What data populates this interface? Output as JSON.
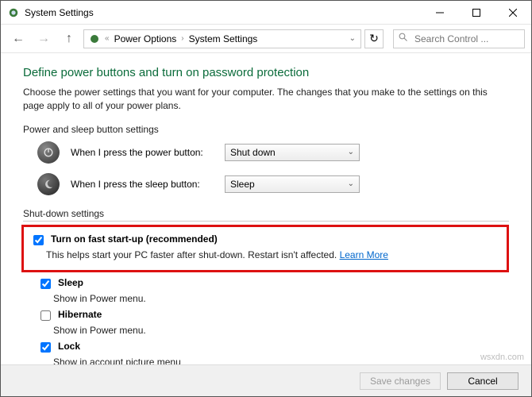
{
  "window": {
    "title": "System Settings"
  },
  "nav": {
    "breadcrumb": {
      "level1": "Power Options",
      "level2": "System Settings"
    },
    "search_placeholder": "Search Control ..."
  },
  "main": {
    "heading": "Define power buttons and turn on password protection",
    "description": "Choose the power settings that you want for your computer. The changes that you make to the settings on this page apply to all of your power plans.",
    "button_settings": {
      "title": "Power and sleep button settings",
      "power_label": "When I press the power button:",
      "power_value": "Shut down",
      "sleep_label": "When I press the sleep button:",
      "sleep_value": "Sleep"
    },
    "shutdown": {
      "title": "Shut-down settings",
      "fast_startup": {
        "label": "Turn on fast start-up (recommended)",
        "desc": "This helps start your PC faster after shut-down. Restart isn't affected.",
        "learn": "Learn More"
      },
      "sleep": {
        "label": "Sleep",
        "desc": "Show in Power menu."
      },
      "hibernate": {
        "label": "Hibernate",
        "desc": "Show in Power menu."
      },
      "lock": {
        "label": "Lock",
        "desc": "Show in account picture menu"
      }
    }
  },
  "footer": {
    "save": "Save changes",
    "cancel": "Cancel"
  },
  "watermark": "wsxdn.com"
}
